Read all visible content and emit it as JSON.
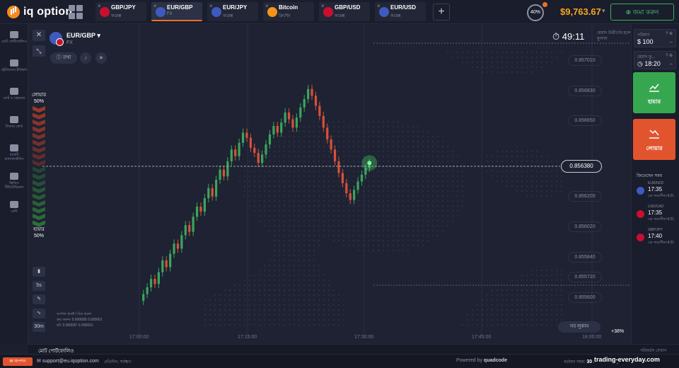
{
  "app": {
    "logo": "iq option"
  },
  "tabs": [
    {
      "symbol": "GBP/JPY",
      "type": "ফরেক্স",
      "flag_color": "#c8102e",
      "active": false
    },
    {
      "symbol": "EUR/GBP",
      "type": "FX",
      "flag_color": "#3d5bbf",
      "active": true
    },
    {
      "symbol": "EUR/JPY",
      "type": "ফরেক্স",
      "flag_color": "#3d5bbf",
      "active": false
    },
    {
      "symbol": "Bitcoin",
      "type": "ক্রিপ্টো",
      "flag_color": "#f7931a",
      "active": false
    },
    {
      "symbol": "GBP/USD",
      "type": "ফরেক্স",
      "flag_color": "#c8102e",
      "active": false
    },
    {
      "symbol": "EUR/USD",
      "type": "ফরেক্স",
      "flag_color": "#3d5bbf",
      "active": false
    }
  ],
  "header": {
    "progress_pct": "40%",
    "balance": "$9,763.67",
    "deposit_label": "জমা করুন"
  },
  "sidebar": [
    {
      "label": "মোট পোর্টফোলিও",
      "icon": "briefcase-icon"
    },
    {
      "label": "ট্রেডিংয়ের ইতিহাস",
      "icon": "clock-icon"
    },
    {
      "label": "চ্যাট ও সহায়তা",
      "icon": "chat-icon"
    },
    {
      "label": "লিডার বোর্ড",
      "icon": "trophy-icon"
    },
    {
      "label": "মার্কেট অ্যানালাইসিস",
      "icon": "chart-icon"
    },
    {
      "label": "ভিডিও টিউটোরিয়াল",
      "icon": "play-icon"
    },
    {
      "label": "বেশি",
      "icon": "more-icon"
    }
  ],
  "asset": {
    "name": "EUR/GBP",
    "type": "FX",
    "info_label": "তথ্য"
  },
  "timer": {
    "value": "49:11",
    "label": "মেয়াদ উত্তীর্ণের হলে মুনাফা"
  },
  "sentiment": {
    "lower_label": "লোয়ার",
    "lower_pct": "50%",
    "higher_label": "হায়ার",
    "higher_pct": "50%"
  },
  "tools": [
    "5s",
    "30m"
  ],
  "legend_small": {
    "line1": "অপশন অ্যাক্ট / বিড করুন",
    "line2": "ক্রয় করুন: 0.000695  0.000001",
    "line3": "ছট: 0.000687  0.000001"
  },
  "chart_data": {
    "type": "candlestick",
    "symbol": "EUR/GBP",
    "ylim": [
      0.8555,
      0.8571
    ],
    "y_ticks": [
      0.85701,
      0.85683,
      0.85665,
      0.8562,
      0.85602,
      0.85584,
      0.85572,
      0.8556
    ],
    "y_tick_labels": [
      "0.857010",
      "0.856830",
      "0.856650",
      "0.856200",
      "0.856020",
      "0.855840",
      "0.855720",
      "0.855600"
    ],
    "current_price": 0.85638,
    "current_price_label": "0.856380",
    "x_tick_labels": [
      "17:00:00",
      "17:15:00",
      "17:30:00",
      "17:45:00",
      "18:00:00"
    ],
    "close": [
      0.85562,
      0.85566,
      0.85571,
      0.85568,
      0.85575,
      0.85582,
      0.85578,
      0.85586,
      0.85592,
      0.85589,
      0.85597,
      0.85603,
      0.85599,
      0.85608,
      0.85614,
      0.85611,
      0.85619,
      0.85625,
      0.8562,
      0.8563,
      0.85636,
      0.85632,
      0.85641,
      0.85648,
      0.85644,
      0.85652,
      0.85658,
      0.85655,
      0.85649,
      0.85646,
      0.8564,
      0.85645,
      0.85651,
      0.85657,
      0.85662,
      0.85658,
      0.85664,
      0.8567,
      0.85666,
      0.85661,
      0.85667,
      0.85673,
      0.85678,
      0.85684,
      0.8568,
      0.85674,
      0.85668,
      0.85661,
      0.85654,
      0.85648,
      0.85641,
      0.85634,
      0.85628,
      0.85622,
      0.85618,
      0.85624,
      0.85629,
      0.85633,
      0.85637,
      0.8564
    ]
  },
  "controls": {
    "hide_all_label": "সব লুকান",
    "percent_label": "+38%"
  },
  "right_panel": {
    "amount_label": "পরিমাণ",
    "amount_value": "$ 100",
    "expiry_label": "মেয়াদ ফু...",
    "expiry_value": "18:20",
    "higher_label": "হায়ার",
    "lower_label": "লোয়ার",
    "popular_title": "জিতেছেন সময়"
  },
  "popular_items": [
    {
      "pair": "EUR/NZD",
      "time": "17:35",
      "sub": "এর সময়সীমা:4:21",
      "flag_color": "#3d5bbf"
    },
    {
      "pair": "USD/CAD",
      "time": "17:35",
      "sub": "এর সময়সীমা:4:21",
      "flag_color": "#c8102e"
    },
    {
      "pair": "GBP/JPY",
      "time": "17:40",
      "sub": "এর সময়সীমা:4:21",
      "flag_color": "#c8102e"
    }
  ],
  "portfolio": {
    "left": "মোট পোর্টফোলিও",
    "right": "পরিবর্তন দেখান"
  },
  "footer": {
    "live_label": "অপশন",
    "support_email": "support@eu.iqoption.com",
    "support_sub": "প্রতিদিন, সর্বক্ষণ",
    "powered_prefix": "Powered by",
    "powered_brand": "quadcode",
    "time_prefix": "বর্তমান সময়:",
    "time_value": "30 JANUARY, 17:30:00"
  },
  "watermark": "trading-everyday.com"
}
